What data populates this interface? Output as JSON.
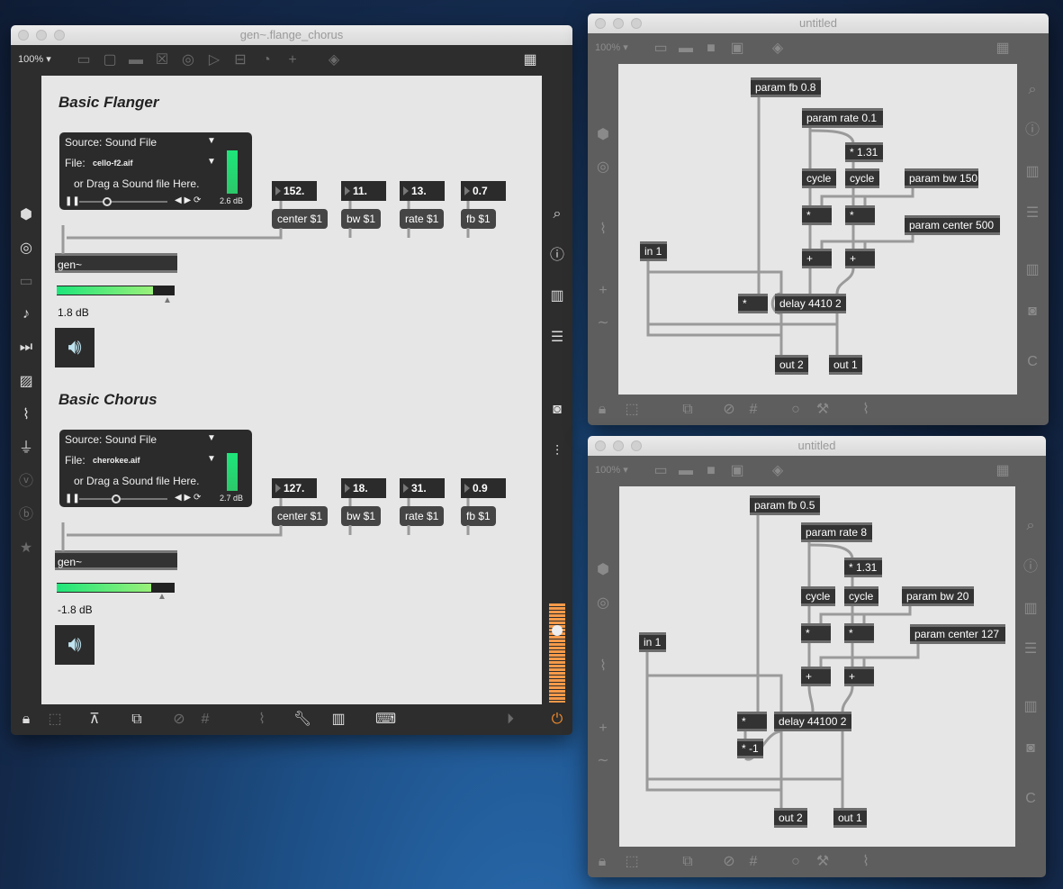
{
  "main_window": {
    "title": "gen~.flange_chorus",
    "zoom": "100%",
    "flanger": {
      "heading": "Basic Flanger",
      "source": "Source: Sound File",
      "file_label": "File:",
      "file": "cello-f2.aif",
      "drag_hint": "or Drag a Sound file Here.",
      "level": "2.6 dB",
      "numbers": [
        "152.",
        "11.",
        "13.",
        "0.7"
      ],
      "messages": [
        "center $1",
        "bw $1",
        "rate $1",
        "fb $1"
      ],
      "gen_label": "gen~",
      "gain": "1.8 dB",
      "playhead_fraction": 0.3
    },
    "chorus": {
      "heading": "Basic Chorus",
      "source": "Source: Sound File",
      "file_label": "File:",
      "file": "cherokee.aif",
      "drag_hint": "or Drag a Sound file Here.",
      "level": "2.7 dB",
      "numbers": [
        "127.",
        "18.",
        "31.",
        "0.9"
      ],
      "messages": [
        "center $1",
        "bw $1",
        "rate $1",
        "fb $1"
      ],
      "gen_label": "gen~",
      "gain": "-1.8 dB",
      "playhead_fraction": 0.4
    }
  },
  "flanger_patch": {
    "title": "untitled",
    "zoom": "100%",
    "objects": {
      "fb": "param fb 0.8",
      "rate": "param rate 0.1",
      "mul131": "* 1.31",
      "cycle1": "cycle",
      "cycle2": "cycle",
      "bw": "param bw 150",
      "mul1": "*",
      "mul2": "*",
      "center": "param center 500",
      "add1": "+",
      "add2": "+",
      "in1": "in 1",
      "fbmul": "*",
      "delay": "delay 4410 2",
      "out2": "out 2",
      "out1": "out 1"
    }
  },
  "chorus_patch": {
    "title": "untitled",
    "zoom": "100%",
    "objects": {
      "fb": "param fb 0.5",
      "rate": "param rate 8",
      "mul131": "* 1.31",
      "cycle1": "cycle",
      "cycle2": "cycle",
      "bw": "param bw 20",
      "mul1": "*",
      "mul2": "*",
      "center": "param center 127",
      "add1": "+",
      "add2": "+",
      "in1": "in 1",
      "fbmul": "*",
      "neg": "* -1",
      "delay": "delay 44100 2",
      "out2": "out 2",
      "out1": "out 1"
    }
  },
  "colors": {
    "meter_green": "#1ee57a",
    "power": "#f08a2a",
    "canvas": "#e6e6e6"
  }
}
